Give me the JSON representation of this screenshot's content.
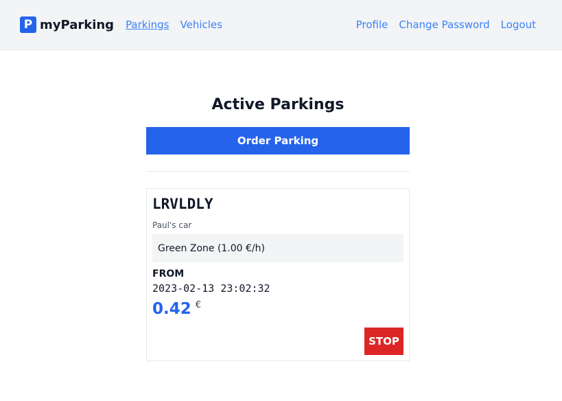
{
  "navbar": {
    "brand_logo": "P",
    "brand_name": "myParking",
    "left_links": [
      "Parkings",
      "Vehicles"
    ],
    "right_links": [
      "Profile",
      "Change Password",
      "Logout"
    ]
  },
  "main": {
    "title": "Active Parkings",
    "order_button": "Order Parking"
  },
  "parking": {
    "plate": "LRVLDLY",
    "vehicle_description": "Paul's car",
    "zone": "Green Zone (1.00 €/h)",
    "from_label": "FROM",
    "from_time": "2023-02-13 23:02:32",
    "price": "0.42",
    "currency": "€",
    "stop_button": "STOP"
  },
  "colors": {
    "primary": "#2563eb",
    "danger": "#dc2626",
    "navbar_bg": "#f3f4f6",
    "link": "#3b82f6"
  }
}
